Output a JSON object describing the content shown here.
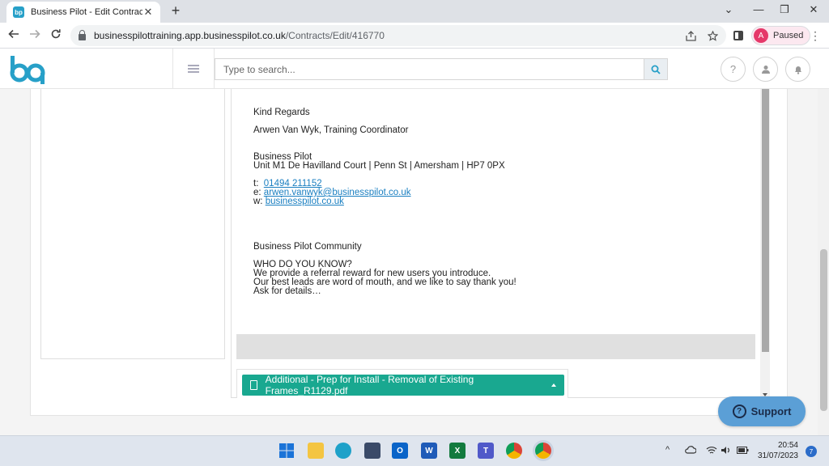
{
  "browser": {
    "tab_title": "Business Pilot - Edit Contract",
    "tab_favicon_text": "bp",
    "tab_close": "✕",
    "new_tab": "+",
    "url_host": "businesspilottraining.app.businesspilot.co.uk",
    "url_path": "/Contracts/Edit/416770",
    "profile_initial": "A",
    "profile_label": "Paused",
    "window_controls": {
      "minimize": "⌄",
      "restore": "—",
      "maximize": "❐",
      "close": "✕"
    }
  },
  "header": {
    "search_placeholder": "Type to search...",
    "help_icon": "?",
    "colors": {
      "brand": "#27a0c8",
      "accent": "#19a890"
    }
  },
  "email": {
    "greeting": "Kind Regards",
    "signature_name": "Arwen Van Wyk, Training Coordinator",
    "company": "Business Pilot",
    "address": "Unit M1 De Havilland Court | Penn St | Amersham | HP7 0PX",
    "phone_prefix": "t:",
    "phone": "01494 211152",
    "email_prefix": "e:",
    "email": "arwen.vanwyk@businesspilot.co.uk",
    "web_prefix": "w:",
    "web": "businesspilot.co.uk",
    "community_title": "Business Pilot Community",
    "who_title": "WHO DO YOU KNOW?",
    "line1": "We provide a referral reward for new users you introduce.",
    "line2": "Our best leads are word of mouth, and we like to say thank you!",
    "line3": "Ask for details…"
  },
  "attachment": {
    "label": "Additional - Prep for Install - Removal of Existing Frames_R1129.pdf"
  },
  "support": {
    "label": "Support",
    "icon": "?"
  },
  "taskbar": {
    "time": "20:54",
    "date": "31/07/2023",
    "notifications": "7",
    "tray_chevron": "^"
  }
}
